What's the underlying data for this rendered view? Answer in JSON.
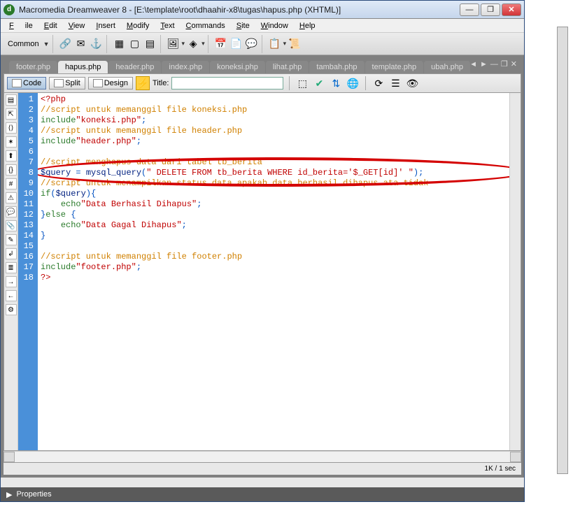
{
  "titlebar": {
    "icon_char": "d",
    "text": "Macromedia Dreamweaver 8 - [E:\\template\\root\\dhaahir-x8\\tugas\\hapus.php (XHTML)]"
  },
  "menu": {
    "file": "File",
    "edit": "Edit",
    "view": "View",
    "insert": "Insert",
    "modify": "Modify",
    "text": "Text",
    "commands": "Commands",
    "site": "Site",
    "window": "Window",
    "help": "Help"
  },
  "toolbar": {
    "category": "Common",
    "dd": "▼"
  },
  "tabs": {
    "items": [
      {
        "label": "footer.php"
      },
      {
        "label": "hapus.php"
      },
      {
        "label": "header.php"
      },
      {
        "label": "index.php"
      },
      {
        "label": "koneksi.php"
      },
      {
        "label": "lihat.php"
      },
      {
        "label": "tambah.php"
      },
      {
        "label": "template.php"
      },
      {
        "label": "ubah.php"
      }
    ],
    "active_index": 1
  },
  "doc_toolbar": {
    "code": "Code",
    "split": "Split",
    "design": "Design",
    "title_label": "Title:",
    "title_value": ""
  },
  "code": {
    "lines": [
      {
        "cls": "c-red",
        "text": "<?php"
      },
      {
        "cls": "c-orange",
        "text": "//script untuk memanggil file koneksi.php"
      },
      {
        "cls": "",
        "text": "include\"koneksi.php\";"
      },
      {
        "cls": "c-orange",
        "text": "//script untuk memanggil file header.php"
      },
      {
        "cls": "",
        "text": "include\"header.php\";"
      },
      {
        "cls": "",
        "text": ""
      },
      {
        "cls": "c-orange",
        "text": "//script menghapus data dari tabel tb_berita"
      },
      {
        "cls": "",
        "text": "$query = mysql_query(\" DELETE FROM tb_berita WHERE id_berita='$_GET[id]' \");"
      },
      {
        "cls": "c-orange",
        "text": "//script untuk menampilkan status data apakah data berhasil dihapus ata tidak"
      },
      {
        "cls": "",
        "text": "if($query){"
      },
      {
        "cls": "",
        "text": "    echo\"Data Berhasil Dihapus\";"
      },
      {
        "cls": "",
        "text": "}else {"
      },
      {
        "cls": "",
        "text": "    echo\"Data Gagal Dihapus\";"
      },
      {
        "cls": "",
        "text": "}"
      },
      {
        "cls": "",
        "text": ""
      },
      {
        "cls": "c-orange",
        "text": "//script untuk memanggil file footer.php"
      },
      {
        "cls": "",
        "text": "include\"footer.php\";"
      },
      {
        "cls": "c-red",
        "text": "?> "
      }
    ]
  },
  "status": {
    "text": "1K / 1 sec"
  },
  "props": {
    "label": "Properties",
    "arrow": "▶"
  },
  "win_btns": {
    "min": "—",
    "max": "❐",
    "close": "✕"
  }
}
